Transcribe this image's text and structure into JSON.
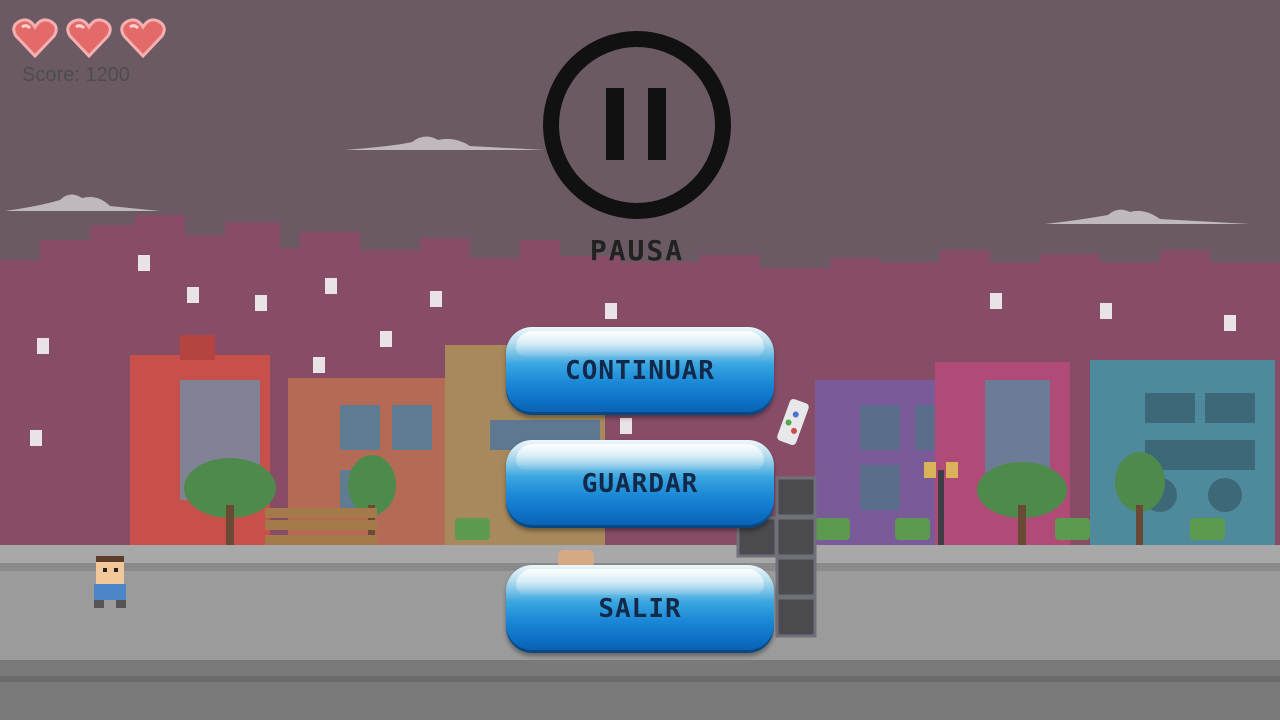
{
  "hud": {
    "lives": 3,
    "score_text": "Score: 1200"
  },
  "pause": {
    "title": "PAUSA",
    "icon": "pause-icon"
  },
  "menu": {
    "continue_label": "CONTINUAR",
    "save_label": "GUARDAR",
    "exit_label": "SALIR"
  },
  "colors": {
    "sky": "#6b5a63",
    "skyline": "#8a4e68",
    "button_blue": "#1c8ad8",
    "heart": "#e46a6a"
  }
}
